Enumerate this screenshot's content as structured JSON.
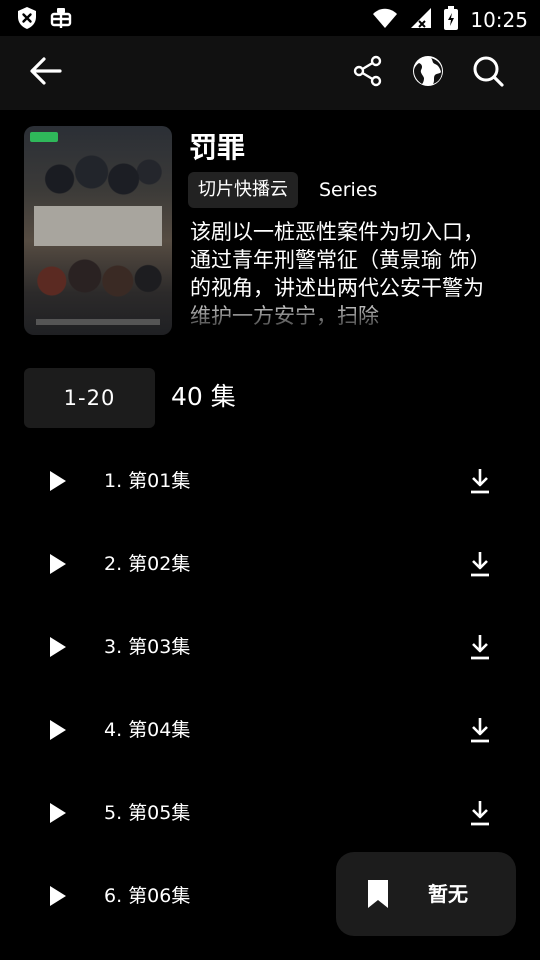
{
  "status_bar": {
    "time": "10:25",
    "left_icons": [
      "shield-x-icon",
      "bug-icon"
    ],
    "right_icons": [
      "wifi-icon",
      "signal-icon",
      "battery-icon"
    ]
  },
  "toolbar": {
    "back_icon": "arrow-left-icon",
    "actions": [
      "share-icon",
      "globe-icon",
      "search-icon"
    ]
  },
  "show": {
    "title": "罚罪",
    "source": "切片快播云",
    "type": "Series",
    "description": "该剧以一桩恶性案件为切入口，通过青年刑警常征（黄景瑜 饰）的视角，讲述出两代公安干警为维护一方安宁，扫除",
    "poster_icon": "drama-poster"
  },
  "episodes_section": {
    "range_label": "1-20",
    "count_label": "40 集"
  },
  "episodes": [
    {
      "label": "1. 第01集"
    },
    {
      "label": "2. 第02集"
    },
    {
      "label": "3. 第03集"
    },
    {
      "label": "4. 第04集"
    },
    {
      "label": "5. 第05集"
    },
    {
      "label": "6. 第06集"
    }
  ],
  "fab": {
    "label": "暂无",
    "icon": "bookmark-icon"
  },
  "colors": {
    "background": "#000000",
    "toolbar": "#111111",
    "chip": "#1c1c1c",
    "text": "#ffffff"
  }
}
